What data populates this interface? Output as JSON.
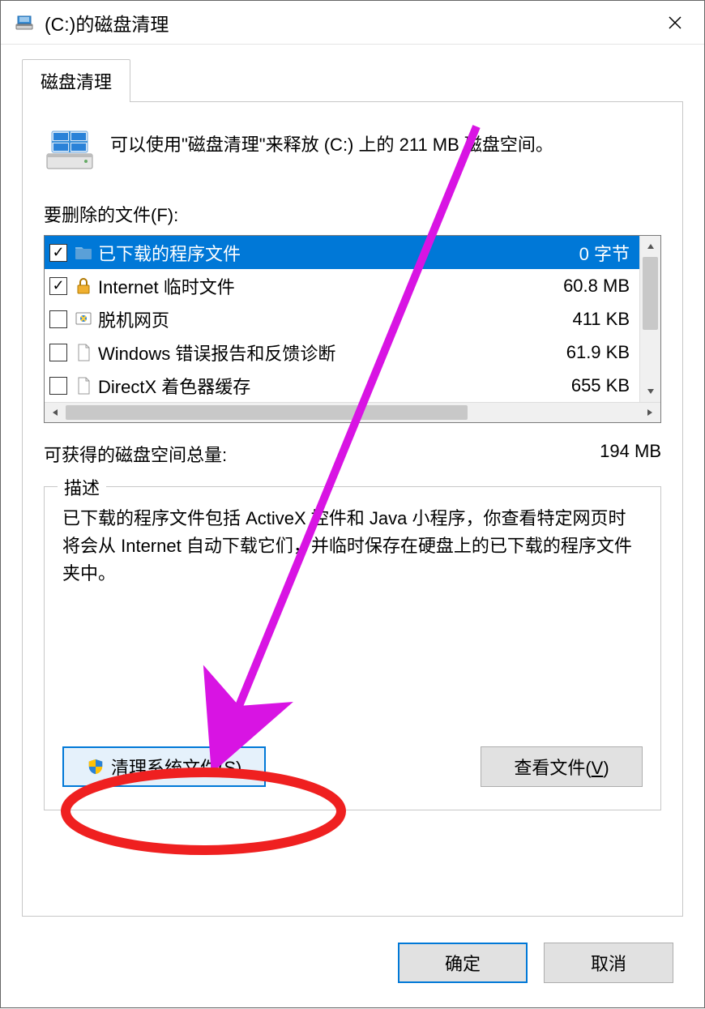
{
  "titlebar": {
    "title": "(C:)的磁盘清理"
  },
  "tab": {
    "label": "磁盘清理"
  },
  "summary": "可以使用\"磁盘清理\"来释放  (C:) 上的 211 MB 磁盘空间。",
  "files_label": "要删除的文件(F):",
  "files": [
    {
      "checked": true,
      "label": "已下载的程序文件",
      "size": "0 字节",
      "selected": true,
      "icon": "folder-blue"
    },
    {
      "checked": true,
      "label": "Internet 临时文件",
      "size": "60.8 MB",
      "selected": false,
      "icon": "lock"
    },
    {
      "checked": false,
      "label": "脱机网页",
      "size": "411 KB",
      "selected": false,
      "icon": "offline"
    },
    {
      "checked": false,
      "label": "Windows 错误报告和反馈诊断",
      "size": "61.9 KB",
      "selected": false,
      "icon": "file"
    },
    {
      "checked": false,
      "label": "DirectX 着色器缓存",
      "size": "655 KB",
      "selected": false,
      "icon": "file"
    }
  ],
  "total": {
    "label": "可获得的磁盘空间总量:",
    "value": "194 MB"
  },
  "description": {
    "legend": "描述",
    "text": "已下载的程序文件包括 ActiveX 控件和 Java 小程序，你查看特定网页时将会从 Internet 自动下载它们，并临时保存在硬盘上的已下载的程序文件夹中。"
  },
  "buttons": {
    "clean_system": "清理系统文件(S)",
    "view_files_prefix": "查看文件(",
    "view_files_key": "V",
    "view_files_suffix": ")",
    "ok": "确定",
    "cancel": "取消"
  }
}
